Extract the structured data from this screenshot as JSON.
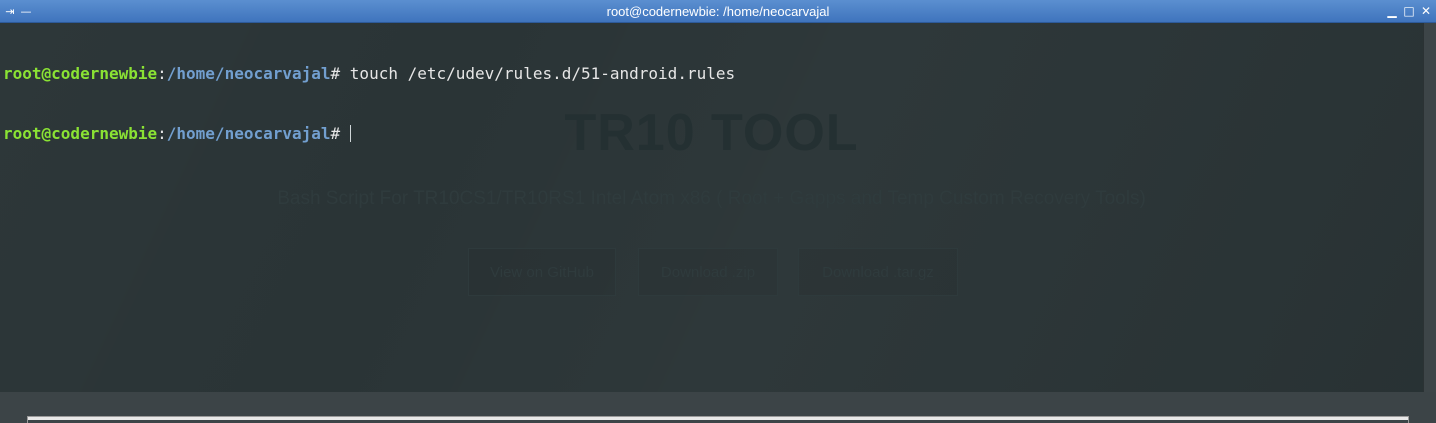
{
  "window": {
    "title": "root@codernewbie: /home/neocarvajal",
    "pin_glyph": "⇥",
    "menu_glyph": "—",
    "minimize_glyph": "▁",
    "maximize_glyph": "□",
    "close_glyph": "✕"
  },
  "terminal": {
    "lines": [
      {
        "user": "root@codernewbie",
        "sep": ":",
        "path": "/home/neocarvajal",
        "prompt": "# ",
        "command": "touch /etc/udev/rules.d/51-android.rules"
      },
      {
        "user": "root@codernewbie",
        "sep": ":",
        "path": "/home/neocarvajal",
        "prompt": "#",
        "command": ""
      }
    ]
  },
  "wallpaper": {
    "title": "TR10 TOOL",
    "subtitle": "Bash Script For TR10CS1/TR10RS1 Intel Atom x86 ( Root + Gapps and Temp Custom Recovery Tools)",
    "buttons": [
      "View on GitHub",
      "Download .zip",
      "Download .tar.gz"
    ]
  },
  "colors": {
    "titlebar": "#4a80c6",
    "terminal_bg": "#2a3436",
    "user": "#8ae234",
    "path": "#729fcf"
  }
}
